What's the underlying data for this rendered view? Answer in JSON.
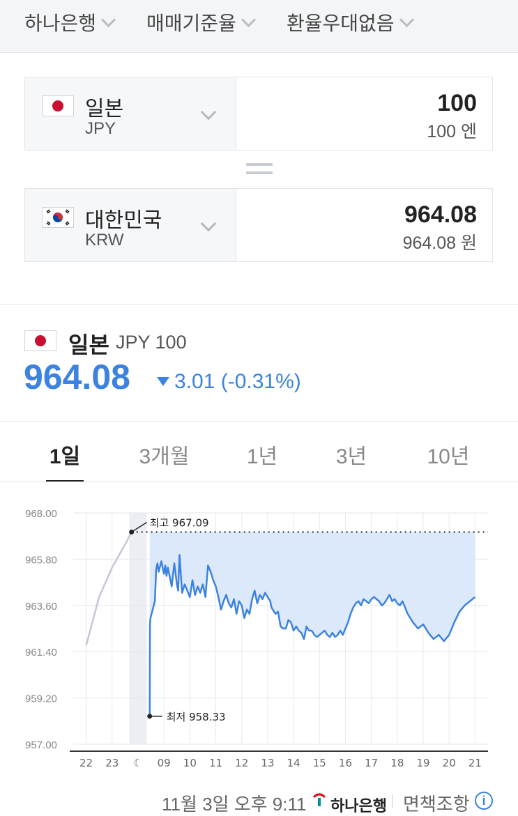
{
  "filters": {
    "bank": "하나은행",
    "rate_basis": "매매기준율",
    "preferential": "환율우대없음"
  },
  "converter": {
    "from": {
      "name": "일본",
      "code": "JPY",
      "amount": "100",
      "amount_sub": "100 엔"
    },
    "to": {
      "name": "대한민국",
      "code": "KRW",
      "amount": "964.08",
      "amount_sub": "964.08 원"
    }
  },
  "summary": {
    "name": "일본",
    "code_unit": "JPY 100",
    "rate": "964.08",
    "change": "3.01 (-0.31%)",
    "direction": "down"
  },
  "periods": [
    "1일",
    "3개월",
    "1년",
    "3년",
    "10년"
  ],
  "active_period": "1일",
  "footer": {
    "timestamp": "11월 3일 오후 9:11",
    "bank_logo": "하나은행",
    "disclaimer": "면책조항"
  },
  "colors": {
    "accent": "#3c82e0",
    "fill": "#dbe9fa",
    "prev_line": "#c5c7d6"
  },
  "chart_data": {
    "type": "line",
    "ylim": [
      957.0,
      968.0
    ],
    "yticks": [
      "968.00",
      "965.80",
      "963.60",
      "961.40",
      "959.20",
      "957.00"
    ],
    "xticks": [
      "22",
      "23",
      "☾",
      "09",
      "10",
      "11",
      "12",
      "13",
      "14",
      "15",
      "16",
      "17",
      "18",
      "19",
      "20",
      "21"
    ],
    "high_label": "최고 967.09",
    "low_label": "최저 958.33",
    "high": 967.09,
    "low": 958.33,
    "series": [
      {
        "role": "previous",
        "x": [
          0,
          0.5,
          1.0,
          1.5,
          1.75
        ],
        "y": [
          961.7,
          964.0,
          965.4,
          966.5,
          967.09
        ]
      },
      {
        "role": "today",
        "x": [
          2.45,
          2.46,
          2.48,
          2.65,
          2.7,
          2.75,
          2.8,
          2.9,
          3.0,
          3.05,
          3.1,
          3.15,
          3.2,
          3.3,
          3.4,
          3.5,
          3.55,
          3.6,
          3.7,
          3.8,
          3.9,
          4.0,
          4.1,
          4.2,
          4.3,
          4.4,
          4.5,
          4.6,
          4.7,
          4.8,
          4.9,
          5.0,
          5.1,
          5.2,
          5.3,
          5.4,
          5.5,
          5.6,
          5.7,
          5.8,
          5.9,
          6.0,
          6.1,
          6.2,
          6.3,
          6.4,
          6.5,
          6.6,
          6.7,
          6.8,
          6.9,
          7.0,
          7.1,
          7.15,
          7.3,
          7.4,
          7.5,
          7.6,
          7.7,
          7.8,
          7.9,
          8.0,
          8.1,
          8.2,
          8.3,
          8.4,
          8.5,
          8.6,
          8.7,
          8.8,
          8.9,
          9.0,
          9.1,
          9.2,
          9.3,
          9.4,
          9.5,
          9.6,
          9.7,
          9.8,
          9.9,
          10.0,
          10.1,
          10.2,
          10.3,
          10.4,
          10.5,
          10.6,
          10.7,
          10.8,
          10.9,
          11.0,
          11.1,
          11.2,
          11.3,
          11.4,
          11.5,
          11.6,
          11.7,
          11.8,
          11.9,
          12.0,
          12.1,
          12.2,
          12.4,
          12.6,
          12.8,
          13.0,
          13.2,
          13.4,
          13.6,
          13.8,
          14.0,
          14.2,
          14.4,
          14.6,
          14.8,
          15.0
        ],
        "y": [
          958.33,
          962.7,
          963.0,
          963.8,
          965.3,
          965.6,
          965.2,
          965.7,
          965.1,
          965.5,
          965.0,
          965.4,
          965.1,
          964.5,
          965.6,
          964.6,
          964.3,
          966.0,
          964.2,
          964.6,
          964.3,
          964.0,
          964.8,
          964.1,
          964.5,
          964.2,
          964.6,
          964.0,
          965.5,
          965.2,
          964.8,
          964.5,
          964.0,
          963.4,
          963.8,
          964.1,
          963.7,
          963.5,
          963.9,
          963.2,
          963.8,
          963.6,
          963.0,
          963.4,
          963.2,
          963.9,
          964.3,
          963.7,
          964.1,
          963.9,
          964.2,
          964.0,
          963.8,
          963.5,
          963.2,
          963.3,
          962.6,
          962.5,
          962.5,
          962.9,
          962.8,
          962.4,
          962.6,
          962.4,
          962.3,
          962.0,
          962.6,
          962.4,
          962.4,
          962.2,
          962.1,
          962.2,
          962.3,
          962.4,
          962.2,
          962.1,
          962.3,
          962.1,
          962.2,
          962.4,
          962.2,
          962.5,
          962.8,
          963.2,
          963.5,
          963.7,
          963.8,
          963.6,
          963.9,
          963.8,
          963.7,
          963.9,
          964.0,
          963.9,
          963.8,
          963.6,
          963.7,
          963.9,
          964.1,
          963.8,
          963.9,
          963.7,
          963.6,
          963.8,
          963.2,
          962.8,
          962.5,
          962.7,
          962.3,
          962.0,
          962.2,
          961.9,
          962.2,
          962.8,
          963.3,
          963.6,
          963.8,
          964.0
        ]
      }
    ]
  }
}
